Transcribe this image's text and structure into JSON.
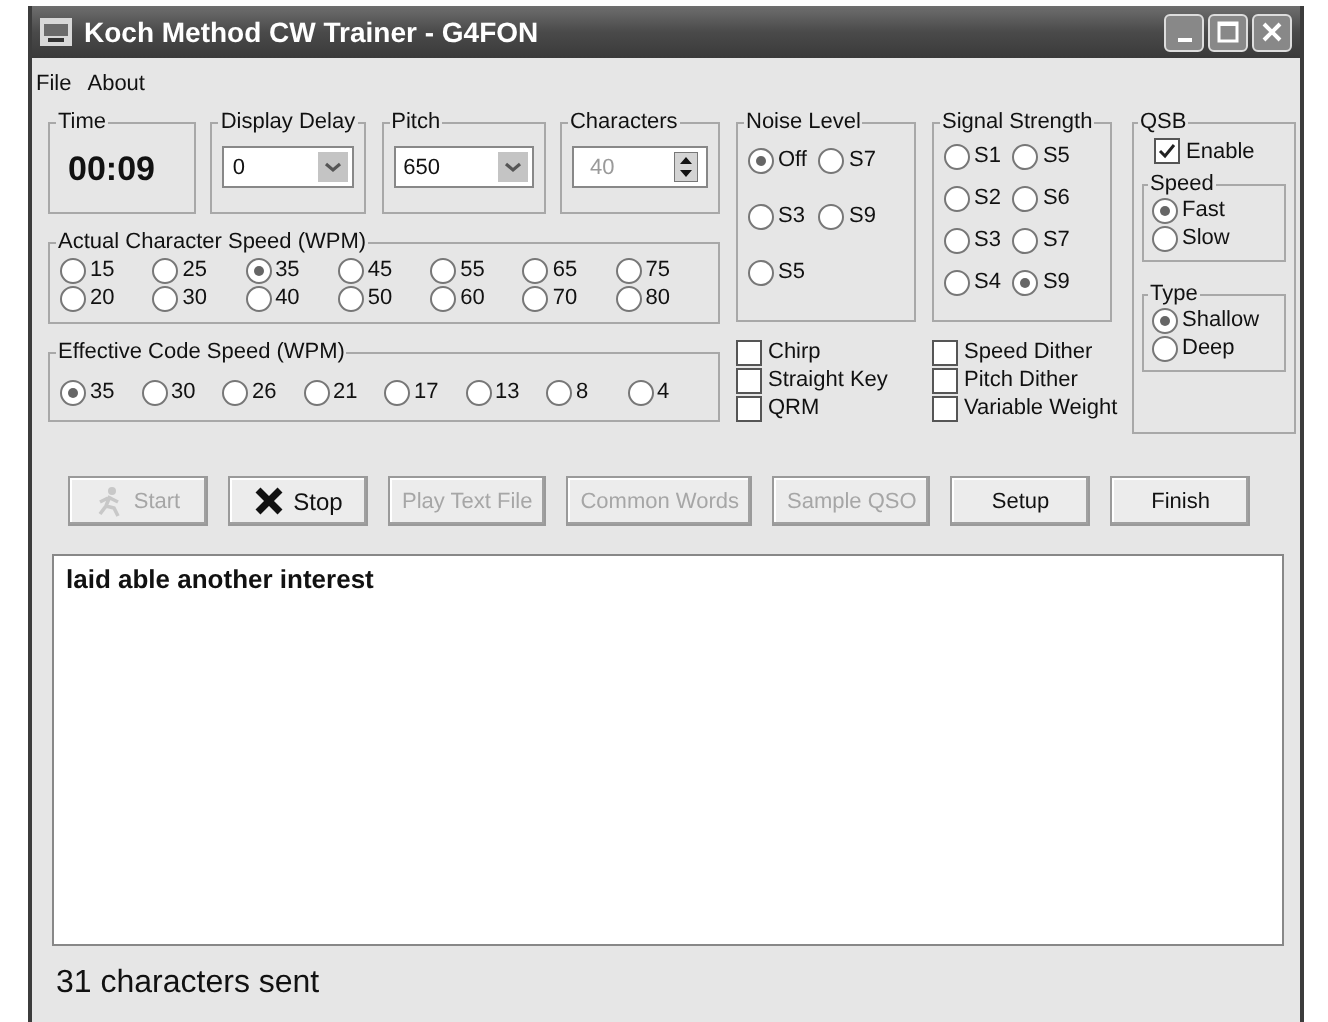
{
  "window": {
    "title": "Koch Method CW Trainer - G4FON"
  },
  "menu": [
    {
      "label": "File"
    },
    {
      "label": "About"
    }
  ],
  "time": {
    "label": "Time",
    "value": "00:09"
  },
  "display_delay": {
    "label": "Display Delay",
    "value": "0"
  },
  "pitch": {
    "label": "Pitch",
    "value": "650"
  },
  "characters": {
    "label": "Characters",
    "value": "40",
    "disabled": true
  },
  "actual_speed": {
    "label": "Actual Character Speed (WPM)",
    "options": [
      {
        "label": "15",
        "selected": false
      },
      {
        "label": "25",
        "selected": false
      },
      {
        "label": "35",
        "selected": true
      },
      {
        "label": "45",
        "selected": false
      },
      {
        "label": "55",
        "selected": false
      },
      {
        "label": "65",
        "selected": false
      },
      {
        "label": "75",
        "selected": false
      },
      {
        "label": "20",
        "selected": false
      },
      {
        "label": "30",
        "selected": false
      },
      {
        "label": "40",
        "selected": false
      },
      {
        "label": "50",
        "selected": false
      },
      {
        "label": "60",
        "selected": false
      },
      {
        "label": "70",
        "selected": false
      },
      {
        "label": "80",
        "selected": false
      }
    ]
  },
  "effective_speed": {
    "label": "Effective Code Speed (WPM)",
    "options": [
      {
        "label": "35",
        "selected": true
      },
      {
        "label": "30",
        "selected": false
      },
      {
        "label": "26",
        "selected": false
      },
      {
        "label": "21",
        "selected": false
      },
      {
        "label": "17",
        "selected": false
      },
      {
        "label": "13",
        "selected": false
      },
      {
        "label": "8",
        "selected": false
      },
      {
        "label": "4",
        "selected": false
      }
    ]
  },
  "noise_level": {
    "label": "Noise Level",
    "options": [
      {
        "label": "Off",
        "selected": true
      },
      {
        "label": "S7",
        "selected": false
      },
      {
        "label": "S3",
        "selected": false
      },
      {
        "label": "S9",
        "selected": false
      },
      {
        "label": "S5",
        "selected": false
      }
    ]
  },
  "signal_strength": {
    "label": "Signal Strength",
    "options": [
      {
        "label": "S1",
        "selected": false
      },
      {
        "label": "S5",
        "selected": false
      },
      {
        "label": "S2",
        "selected": false
      },
      {
        "label": "S6",
        "selected": false
      },
      {
        "label": "S3",
        "selected": false
      },
      {
        "label": "S7",
        "selected": false
      },
      {
        "label": "S4",
        "selected": false
      },
      {
        "label": "S9",
        "selected": true
      }
    ]
  },
  "qsb": {
    "label": "QSB",
    "enable": {
      "label": "Enable",
      "checked": true
    },
    "speed": {
      "label": "Speed",
      "options": [
        {
          "label": "Fast",
          "selected": true
        },
        {
          "label": "Slow",
          "selected": false
        }
      ]
    },
    "type": {
      "label": "Type",
      "options": [
        {
          "label": "Shallow",
          "selected": true
        },
        {
          "label": "Deep",
          "selected": false
        }
      ]
    }
  },
  "effects": [
    {
      "label": "Chirp",
      "checked": false
    },
    {
      "label": "Straight Key",
      "checked": false
    },
    {
      "label": "QRM",
      "checked": false
    },
    {
      "label": "Speed Dither",
      "checked": false
    },
    {
      "label": "Pitch Dither",
      "checked": false
    },
    {
      "label": "Variable Weight",
      "checked": false
    }
  ],
  "buttons": [
    {
      "label": "Start",
      "kind": "start",
      "disabled": true
    },
    {
      "label": "Stop",
      "kind": "stop",
      "disabled": false
    },
    {
      "label": "Play Text File",
      "kind": "plain",
      "disabled": true
    },
    {
      "label": "Common Words",
      "kind": "plain",
      "disabled": true
    },
    {
      "label": "Sample QSO",
      "kind": "plain",
      "disabled": true
    },
    {
      "label": "Setup",
      "kind": "plain",
      "disabled": false
    },
    {
      "label": "Finish",
      "kind": "plain",
      "disabled": false
    }
  ],
  "output": {
    "text": "laid able another interest"
  },
  "status_bar": {
    "text": "31 characters sent"
  }
}
